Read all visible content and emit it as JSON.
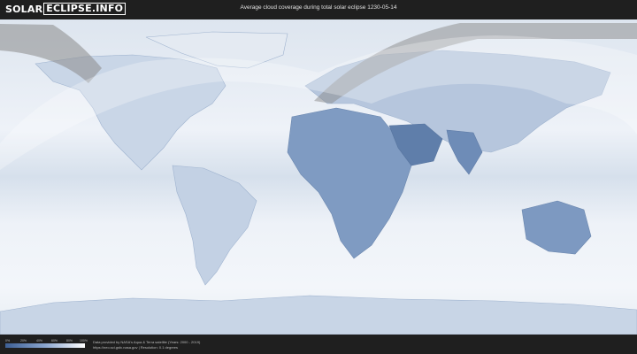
{
  "header": {
    "logo_left": "SOLAR",
    "logo_right": "ECLIPSE.INFO",
    "title": "Average cloud coverage during total solar eclipse 1230-05-14"
  },
  "legend": {
    "ticks": [
      "0%",
      "20%",
      "40%",
      "60%",
      "80%",
      "100%"
    ],
    "colors": {
      "clear": "#3d5f94",
      "cloudy": "#ffffff"
    }
  },
  "footer": {
    "credit_line1": "Data provided by NASA's Aqua & Terra satellite (Years: 2000 - 2019)",
    "credit_line2": "https://neo.sci.gsfc.nasa.gov | Resolution: 0.1 degrees"
  }
}
